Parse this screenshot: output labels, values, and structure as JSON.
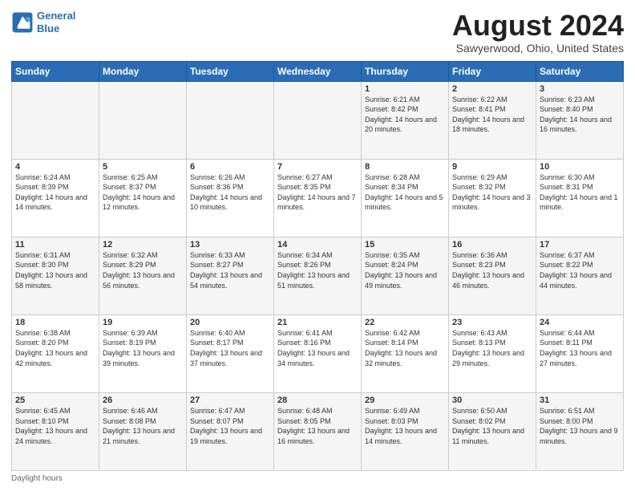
{
  "logo": {
    "line1": "General",
    "line2": "Blue"
  },
  "title": "August 2024",
  "location": "Sawyerwood, Ohio, United States",
  "days_of_week": [
    "Sunday",
    "Monday",
    "Tuesday",
    "Wednesday",
    "Thursday",
    "Friday",
    "Saturday"
  ],
  "footer": "Daylight hours",
  "weeks": [
    [
      {
        "num": "",
        "sunrise": "",
        "sunset": "",
        "daylight": ""
      },
      {
        "num": "",
        "sunrise": "",
        "sunset": "",
        "daylight": ""
      },
      {
        "num": "",
        "sunrise": "",
        "sunset": "",
        "daylight": ""
      },
      {
        "num": "",
        "sunrise": "",
        "sunset": "",
        "daylight": ""
      },
      {
        "num": "1",
        "sunrise": "Sunrise: 6:21 AM",
        "sunset": "Sunset: 8:42 PM",
        "daylight": "Daylight: 14 hours and 20 minutes."
      },
      {
        "num": "2",
        "sunrise": "Sunrise: 6:22 AM",
        "sunset": "Sunset: 8:41 PM",
        "daylight": "Daylight: 14 hours and 18 minutes."
      },
      {
        "num": "3",
        "sunrise": "Sunrise: 6:23 AM",
        "sunset": "Sunset: 8:40 PM",
        "daylight": "Daylight: 14 hours and 16 minutes."
      }
    ],
    [
      {
        "num": "4",
        "sunrise": "Sunrise: 6:24 AM",
        "sunset": "Sunset: 8:39 PM",
        "daylight": "Daylight: 14 hours and 14 minutes."
      },
      {
        "num": "5",
        "sunrise": "Sunrise: 6:25 AM",
        "sunset": "Sunset: 8:37 PM",
        "daylight": "Daylight: 14 hours and 12 minutes."
      },
      {
        "num": "6",
        "sunrise": "Sunrise: 6:26 AM",
        "sunset": "Sunset: 8:36 PM",
        "daylight": "Daylight: 14 hours and 10 minutes."
      },
      {
        "num": "7",
        "sunrise": "Sunrise: 6:27 AM",
        "sunset": "Sunset: 8:35 PM",
        "daylight": "Daylight: 14 hours and 7 minutes."
      },
      {
        "num": "8",
        "sunrise": "Sunrise: 6:28 AM",
        "sunset": "Sunset: 8:34 PM",
        "daylight": "Daylight: 14 hours and 5 minutes."
      },
      {
        "num": "9",
        "sunrise": "Sunrise: 6:29 AM",
        "sunset": "Sunset: 8:32 PM",
        "daylight": "Daylight: 14 hours and 3 minutes."
      },
      {
        "num": "10",
        "sunrise": "Sunrise: 6:30 AM",
        "sunset": "Sunset: 8:31 PM",
        "daylight": "Daylight: 14 hours and 1 minute."
      }
    ],
    [
      {
        "num": "11",
        "sunrise": "Sunrise: 6:31 AM",
        "sunset": "Sunset: 8:30 PM",
        "daylight": "Daylight: 13 hours and 58 minutes."
      },
      {
        "num": "12",
        "sunrise": "Sunrise: 6:32 AM",
        "sunset": "Sunset: 8:29 PM",
        "daylight": "Daylight: 13 hours and 56 minutes."
      },
      {
        "num": "13",
        "sunrise": "Sunrise: 6:33 AM",
        "sunset": "Sunset: 8:27 PM",
        "daylight": "Daylight: 13 hours and 54 minutes."
      },
      {
        "num": "14",
        "sunrise": "Sunrise: 6:34 AM",
        "sunset": "Sunset: 8:26 PM",
        "daylight": "Daylight: 13 hours and 51 minutes."
      },
      {
        "num": "15",
        "sunrise": "Sunrise: 6:35 AM",
        "sunset": "Sunset: 8:24 PM",
        "daylight": "Daylight: 13 hours and 49 minutes."
      },
      {
        "num": "16",
        "sunrise": "Sunrise: 6:36 AM",
        "sunset": "Sunset: 8:23 PM",
        "daylight": "Daylight: 13 hours and 46 minutes."
      },
      {
        "num": "17",
        "sunrise": "Sunrise: 6:37 AM",
        "sunset": "Sunset: 8:22 PM",
        "daylight": "Daylight: 13 hours and 44 minutes."
      }
    ],
    [
      {
        "num": "18",
        "sunrise": "Sunrise: 6:38 AM",
        "sunset": "Sunset: 8:20 PM",
        "daylight": "Daylight: 13 hours and 42 minutes."
      },
      {
        "num": "19",
        "sunrise": "Sunrise: 6:39 AM",
        "sunset": "Sunset: 8:19 PM",
        "daylight": "Daylight: 13 hours and 39 minutes."
      },
      {
        "num": "20",
        "sunrise": "Sunrise: 6:40 AM",
        "sunset": "Sunset: 8:17 PM",
        "daylight": "Daylight: 13 hours and 37 minutes."
      },
      {
        "num": "21",
        "sunrise": "Sunrise: 6:41 AM",
        "sunset": "Sunset: 8:16 PM",
        "daylight": "Daylight: 13 hours and 34 minutes."
      },
      {
        "num": "22",
        "sunrise": "Sunrise: 6:42 AM",
        "sunset": "Sunset: 8:14 PM",
        "daylight": "Daylight: 13 hours and 32 minutes."
      },
      {
        "num": "23",
        "sunrise": "Sunrise: 6:43 AM",
        "sunset": "Sunset: 8:13 PM",
        "daylight": "Daylight: 13 hours and 29 minutes."
      },
      {
        "num": "24",
        "sunrise": "Sunrise: 6:44 AM",
        "sunset": "Sunset: 8:11 PM",
        "daylight": "Daylight: 13 hours and 27 minutes."
      }
    ],
    [
      {
        "num": "25",
        "sunrise": "Sunrise: 6:45 AM",
        "sunset": "Sunset: 8:10 PM",
        "daylight": "Daylight: 13 hours and 24 minutes."
      },
      {
        "num": "26",
        "sunrise": "Sunrise: 6:46 AM",
        "sunset": "Sunset: 8:08 PM",
        "daylight": "Daylight: 13 hours and 21 minutes."
      },
      {
        "num": "27",
        "sunrise": "Sunrise: 6:47 AM",
        "sunset": "Sunset: 8:07 PM",
        "daylight": "Daylight: 13 hours and 19 minutes."
      },
      {
        "num": "28",
        "sunrise": "Sunrise: 6:48 AM",
        "sunset": "Sunset: 8:05 PM",
        "daylight": "Daylight: 13 hours and 16 minutes."
      },
      {
        "num": "29",
        "sunrise": "Sunrise: 6:49 AM",
        "sunset": "Sunset: 8:03 PM",
        "daylight": "Daylight: 13 hours and 14 minutes."
      },
      {
        "num": "30",
        "sunrise": "Sunrise: 6:50 AM",
        "sunset": "Sunset: 8:02 PM",
        "daylight": "Daylight: 13 hours and 11 minutes."
      },
      {
        "num": "31",
        "sunrise": "Sunrise: 6:51 AM",
        "sunset": "Sunset: 8:00 PM",
        "daylight": "Daylight: 13 hours and 9 minutes."
      }
    ]
  ]
}
